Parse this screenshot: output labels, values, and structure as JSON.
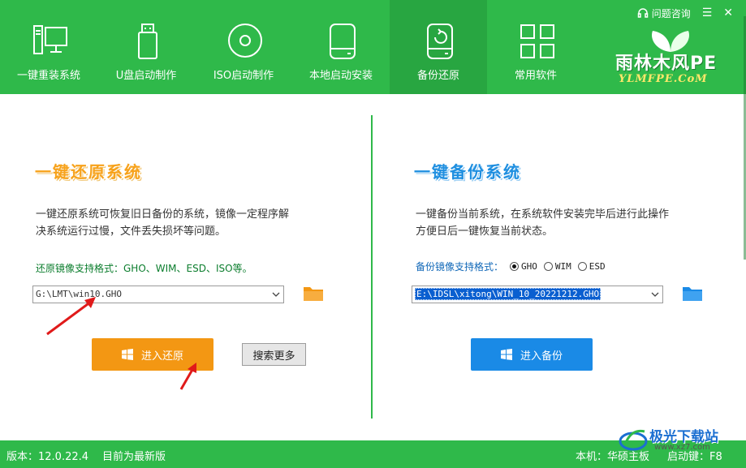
{
  "topbar": {
    "help_label": "问题咨询",
    "menu_icon": "menu-icon",
    "close_icon": "close-icon"
  },
  "tabs": [
    {
      "label": "一键重装系统",
      "icon": "computer-icon",
      "active": false
    },
    {
      "label": "U盘启动制作",
      "icon": "usb-drive-icon",
      "active": false
    },
    {
      "label": "ISO启动制作",
      "icon": "disc-icon",
      "active": false
    },
    {
      "label": "本地启动安装",
      "icon": "hard-disk-icon",
      "active": false
    },
    {
      "label": "备份还原",
      "icon": "backup-disk-icon",
      "active": true
    },
    {
      "label": "常用软件",
      "icon": "apps-grid-icon",
      "active": false
    }
  ],
  "brand": {
    "name": "雨林木风PE",
    "site": "YLMFPE.CoM"
  },
  "restore": {
    "title": "一键还原系统",
    "desc_line1": "一键还原系统可恢复旧日备份的系统，镜像一定程序解",
    "desc_line2": "决系统运行过慢，文件丢失损坏等问题。",
    "formats": "还原镜像支持格式：GHO、WIM、ESD、ISO等。",
    "path": "G:\\LMT\\win10.GHO",
    "button": "进入还原",
    "search_more": "搜索更多"
  },
  "backup": {
    "title": "一键备份系统",
    "desc_line1": "一键备份当前系统，在系统软件安装完毕后进行此操作",
    "desc_line2": "方便日后一键恢复当前状态。",
    "formats_label": "备份镜像支持格式：",
    "options": [
      "GHO",
      "WIM",
      "ESD"
    ],
    "selected": "GHO",
    "path": "E:\\IDSL\\xitong\\WIN_10_20221212.GHO",
    "button": "进入备份"
  },
  "footer": {
    "version": "版本：12.0.22.4",
    "status": "目前为最新版",
    "machine": "本机：华硕主板",
    "boot_key": "启动键：F8"
  },
  "watermark": {
    "text": "极光下载站",
    "url": "www.xz7.com"
  },
  "colors": {
    "green": "#2fb94a",
    "orange": "#f39713",
    "blue": "#1a8ae6",
    "title_orange": "#f7a21b",
    "title_blue": "#1f8fe0"
  }
}
